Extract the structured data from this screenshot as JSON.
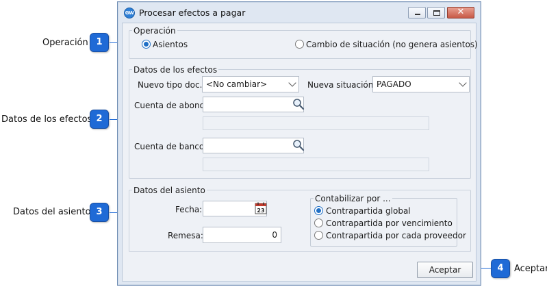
{
  "window": {
    "app_icon_text": "GW",
    "title": "Procesar efectos a pagar"
  },
  "operacion": {
    "legend": "Operación",
    "options": [
      {
        "label": "Asientos",
        "selected": true
      },
      {
        "label": "Cambio de situación (no genera asientos)",
        "selected": false
      }
    ]
  },
  "datos_efectos": {
    "legend": "Datos de los efectos",
    "nuevo_tipo_label": "Nuevo tipo doc.:",
    "nuevo_tipo_value": "<No cambiar>",
    "nueva_situacion_label": "Nueva situación:",
    "nueva_situacion_value": "PAGADO",
    "cuenta_abono_label": "Cuenta de abono:",
    "cuenta_abono_value": "",
    "cuenta_abono_desc": "",
    "cuenta_banco_label": "Cuenta de banco:",
    "cuenta_banco_value": "",
    "cuenta_banco_desc": ""
  },
  "datos_asiento": {
    "legend": "Datos del asiento",
    "fecha_label": "Fecha:",
    "fecha_value": "",
    "calendar_day": "23",
    "remesa_label": "Remesa:",
    "remesa_value": "0",
    "contabilizar": {
      "legend": "Contabilizar por ...",
      "options": [
        {
          "label": "Contrapartida global",
          "selected": true
        },
        {
          "label": "Contrapartida por vencimiento",
          "selected": false
        },
        {
          "label": "Contrapartida por cada proveedor",
          "selected": false
        }
      ]
    }
  },
  "buttons": {
    "accept_label": "Aceptar"
  },
  "callouts": [
    {
      "number": "1",
      "label": "Operación"
    },
    {
      "number": "2",
      "label": "Datos de los efectos"
    },
    {
      "number": "3",
      "label": "Datos del asiento"
    },
    {
      "number": "4",
      "label": "Aceptar"
    }
  ],
  "colors": {
    "accent": "#1f6fc5",
    "callout": "#1f6ad6",
    "close_button": "#c75a47"
  }
}
